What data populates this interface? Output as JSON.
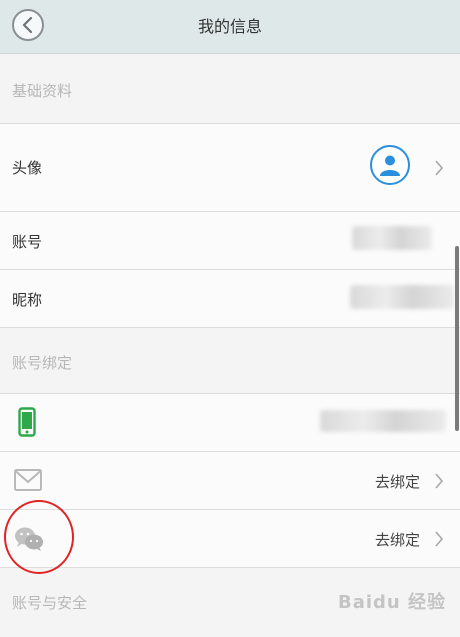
{
  "header": {
    "title": "我的信息"
  },
  "sections": {
    "basic": "基础资料",
    "binding": "账号绑定",
    "security": "账号与安全"
  },
  "rows": {
    "avatar_label": "头像",
    "account_label": "账号",
    "nickname_label": "昵称",
    "email_action": "去绑定",
    "wechat_action": "去绑定"
  },
  "icons": {
    "back": "back-icon",
    "avatar": "user-avatar-icon",
    "phone": "phone-icon",
    "email": "mail-icon",
    "wechat": "wechat-icon",
    "chevron": "chevron-right-icon"
  },
  "colors": {
    "header_bg": "#dfe8e8",
    "avatar_blue": "#2a8fdd",
    "phone_green": "#2ea84a",
    "annotation_red": "#e02424"
  },
  "watermark": "Baidu 经验"
}
